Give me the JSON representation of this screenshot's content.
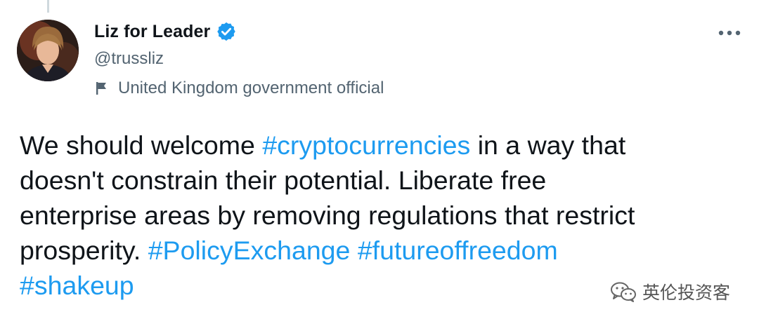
{
  "tweet": {
    "author": {
      "display_name": "Liz for Leader",
      "handle": "@trussliz",
      "verified": true,
      "label": "United Kingdom government official"
    },
    "text_lines": [
      [
        {
          "text": "We should welcome ",
          "type": "text"
        },
        {
          "text": "#cryptocurrencies",
          "type": "hashtag"
        },
        {
          "text": " in a way that",
          "type": "text"
        }
      ],
      [
        {
          "text": "doesn't constrain their potential. Liberate free",
          "type": "text"
        }
      ],
      [
        {
          "text": "enterprise areas by removing regulations that restrict",
          "type": "text"
        }
      ],
      [
        {
          "text": "prosperity. ",
          "type": "text"
        },
        {
          "text": "#PolicyExchange",
          "type": "hashtag"
        },
        {
          "text": " ",
          "type": "text"
        },
        {
          "text": "#futureoffreedom",
          "type": "hashtag"
        }
      ],
      [
        {
          "text": "#shakeup",
          "type": "hashtag"
        }
      ]
    ]
  },
  "watermark": {
    "text": "英伦投资客",
    "icon": "wechat-icon"
  },
  "icons": {
    "verified": "verified-badge-icon",
    "label": "flag-icon",
    "more": "more-options-icon"
  },
  "colors": {
    "hashtag": "#1d9bf0",
    "verified": "#1d9bf0",
    "text": "#0f1419",
    "secondary": "#536471"
  }
}
